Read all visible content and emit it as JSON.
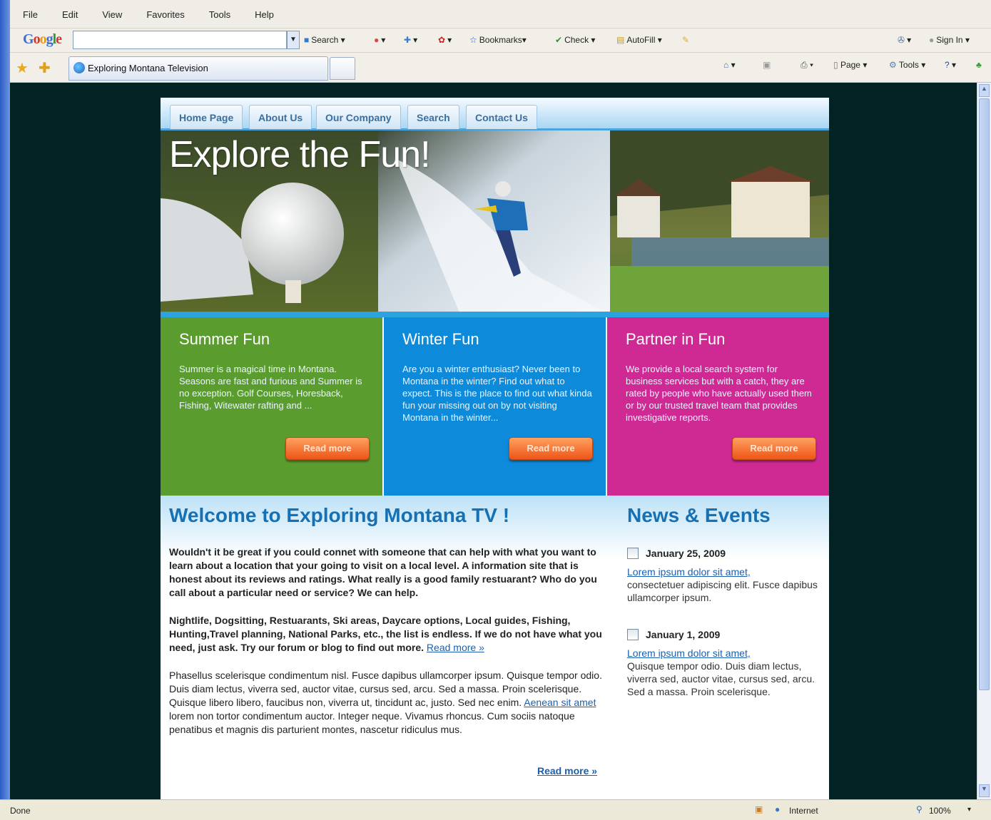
{
  "menu": [
    "File",
    "Edit",
    "View",
    "Favorites",
    "Tools",
    "Help"
  ],
  "google_bar": {
    "logo": "Google",
    "search_label": "Search",
    "bookmarks_label": "Bookmarks",
    "check_label": "Check",
    "autofill_label": "AutoFill",
    "signin_label": "Sign In"
  },
  "tab": {
    "title": "Exploring Montana Television"
  },
  "ie_tools": {
    "page_label": "Page",
    "tools_label": "Tools"
  },
  "site": {
    "nav": [
      "Home Page",
      "About Us",
      "Our Company",
      "Search",
      "Contact Us"
    ],
    "hero_title": "Explore the Fun!",
    "boxes": [
      {
        "title": "Summer Fun",
        "text": "Summer is a magical time in Montana. Seasons are fast and furious and Summer is no exception. Golf Courses, Horesback, Fishing, Witewater rafting and ...",
        "button": "Read more",
        "color": "#5b9c2e"
      },
      {
        "title": "Winter Fun",
        "text": "Are you a winter enthusiast? Never been to Montana in the winter? Find out what to expect. This is the place to find out what kinda fun your missing out on by not visiting Montana in the winter...",
        "button": "Read more",
        "color": "#0d8ad9"
      },
      {
        "title": "Partner in Fun",
        "text": "We provide a local search system for business services but with a catch, they are rated by people who have actually used them or by our trusted travel team that provides investigative reports.",
        "button": "Read more",
        "color": "#cf2a93"
      }
    ],
    "welcome_title": "Welcome to Exploring Montana TV !",
    "para1": "Wouldn't it be great if you could connet with someone that can help with what you want to learn about a location that your going to visit on a local level. A information site that is honest about its reviews and ratings. What really is a good family restuarant? Who do you call about a particular need or service? We can help.",
    "para2": "Nightlife, Dogsitting, Restuarants, Ski areas, Daycare options, Local guides, Fishing, Hunting,Travel planning, National Parks, etc., the list is endless. If we do not have what you need, just ask. Try our forum or blog to find out more.",
    "para2_link": "Read more »",
    "para3": "Phasellus scelerisque condimentum nisl. Fusce dapibus ullamcorper ipsum. Quisque tempor odio. Duis diam lectus, viverra sed, auctor vitae, cursus sed, arcu. Sed a massa. Proin scelerisque.",
    "para4_pre": "Quisque libero libero, faucibus non, viverra ut, tincidunt ac, justo. Sed nec enim.",
    "para4_link": "Aenean sit amet",
    "para4_post": "lorem non tortor condimentum auctor. Integer neque. Vivamus rhoncus. Cum sociis natoque penatibus et magnis dis parturient montes, nascetur ridiculus mus.",
    "read_more_link": "Read more »",
    "news_title": "News & Events",
    "news": [
      {
        "date": "January 25, 2009",
        "link": "Lorem ipsum dolor sit amet,",
        "text": "consectetuer adipiscing elit. Fusce dapibus ullamcorper ipsum."
      },
      {
        "date": "January 1, 2009",
        "link": "Lorem ipsum dolor sit amet,",
        "text": "Quisque tempor odio. Duis diam lectus, viverra sed, auctor vitae, cursus sed, arcu. Sed a massa. Proin scelerisque."
      }
    ]
  },
  "status": {
    "left": "Done",
    "zone": "Internet",
    "zoom": "100%"
  }
}
